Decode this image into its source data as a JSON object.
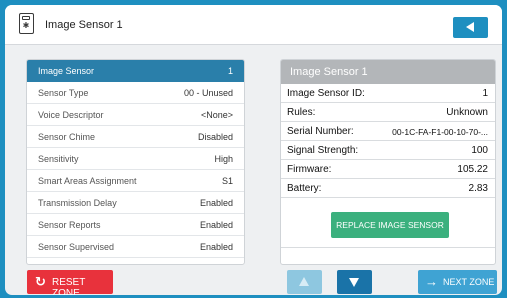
{
  "header": {
    "title": "Image Sensor 1",
    "device_icon": "image-sensor-icon",
    "back_icon": "back-triangle-icon"
  },
  "zone_settings": [
    {
      "label": "Image Sensor",
      "value": "1",
      "active": true
    },
    {
      "label": "Sensor Type",
      "value": "00 - Unused"
    },
    {
      "label": "Voice Descriptor",
      "value": "<None>"
    },
    {
      "label": "Sensor Chime",
      "value": "Disabled"
    },
    {
      "label": "Sensitivity",
      "value": "High"
    },
    {
      "label": "Smart Areas Assignment",
      "value": "S1"
    },
    {
      "label": "Transmission Delay",
      "value": "Enabled"
    },
    {
      "label": "Sensor Reports",
      "value": "Enabled"
    },
    {
      "label": "Sensor Supervised",
      "value": "Enabled"
    }
  ],
  "sensor_info": {
    "heading": "Image Sensor 1",
    "rows": [
      {
        "label": "Image Sensor ID:",
        "value": "1"
      },
      {
        "label": "Rules:",
        "value": "Unknown"
      },
      {
        "label": "Serial Number:",
        "value": "00-1C-FA-F1-00-10-70-..."
      },
      {
        "label": "Signal Strength:",
        "value": "100"
      },
      {
        "label": "Firmware:",
        "value": "105.22"
      },
      {
        "label": "Battery:",
        "value": "2.83"
      }
    ],
    "replace_label": "REPLACE IMAGE SENSOR"
  },
  "footer": {
    "reset_label": "RESET ZONE",
    "next_label": "NEXT ZONE"
  },
  "colors": {
    "brand_blue": "#1e8fc0",
    "active_row": "#2a7faa",
    "reset_red": "#e8323c",
    "replace_green": "#3bb07e"
  }
}
